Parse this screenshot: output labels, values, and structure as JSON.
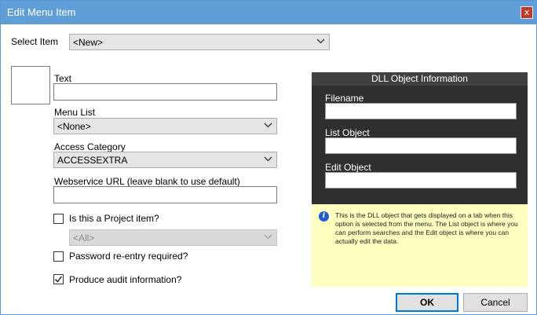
{
  "window": {
    "title": "Edit Menu Item",
    "close_glyph": "x"
  },
  "select_item": {
    "label": "Select Item",
    "value": "<New>"
  },
  "fields": {
    "text_label": "Text",
    "menu_list_label": "Menu List",
    "menu_list_value": "<None>",
    "access_category_label": "Access Category",
    "access_category_value": "ACCESSEXTRA",
    "webservice_label": "Webservice URL (leave blank to use default)"
  },
  "checks": {
    "project_label": "Is this a Project item?",
    "project_checked": false,
    "project_select_value": "<All>",
    "password_label": "Password re-entry required?",
    "password_checked": false,
    "audit_label": "Produce audit information?",
    "audit_checked": true
  },
  "dll": {
    "title": "DLL Object Information",
    "filename_label": "Filename",
    "list_object_label": "List Object",
    "edit_object_label": "Edit Object"
  },
  "info": {
    "icon": "info-icon",
    "text": "This is the DLL object that gets displayed on a tab when this option is selected from the menu.  The List object is where you can perform searches and the Edit object is where you can actually edit the data."
  },
  "buttons": {
    "ok": "OK",
    "cancel": "Cancel"
  },
  "colors": {
    "titlebar": "#5f9ed6",
    "panel": "#2f2f2f",
    "info_bg": "#ffffc0",
    "focus": "#0078d7"
  }
}
